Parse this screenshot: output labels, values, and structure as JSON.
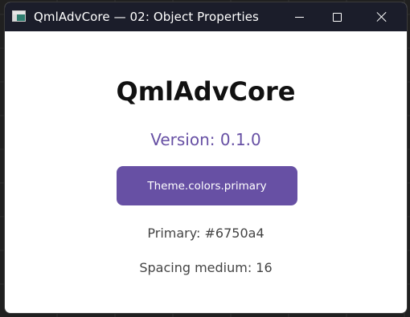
{
  "window": {
    "title": "QmlAdvCore — 02: Object Properties",
    "app_icon": "app-window-icon"
  },
  "title_controls": {
    "minimize_icon": "minimize-icon",
    "maximize_icon": "maximize-icon",
    "close_icon": "close-icon"
  },
  "main": {
    "heading": "QmlAdvCore",
    "version_label": "Version: 0.1.0",
    "primary_button_label": "Theme.colors.primary",
    "primary_info": "Primary: #6750a4",
    "spacing_info": "Spacing medium: 16"
  },
  "colors": {
    "primary": "#6750a4",
    "titlebar": "#1b1d2a",
    "background": "#ffffff"
  }
}
